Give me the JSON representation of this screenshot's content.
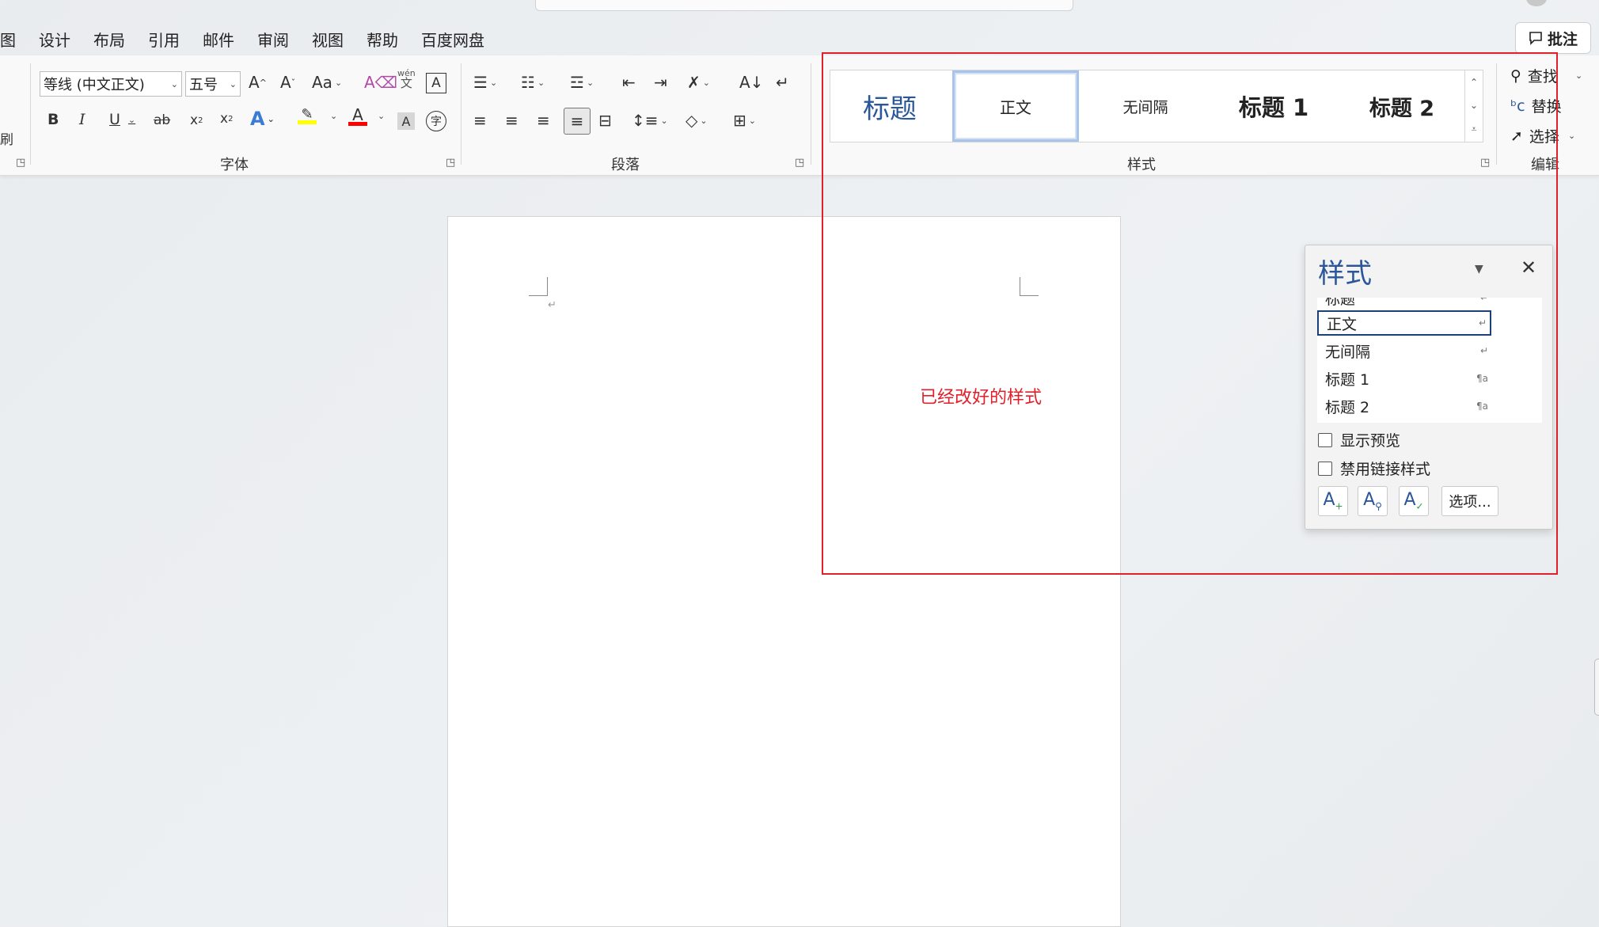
{
  "menu": [
    "图",
    "设计",
    "布局",
    "引用",
    "邮件",
    "审阅",
    "视图",
    "帮助",
    "百度网盘"
  ],
  "comment_button": "批注",
  "font_group": {
    "label": "字体",
    "font_name": "等线 (中文正文)",
    "font_size": "五号",
    "phonetic": "wén",
    "phonetic_char": "文",
    "left_stub": "刷"
  },
  "paragraph_group": {
    "label": "段落"
  },
  "styles_group": {
    "label": "样式",
    "gallery": [
      "标题",
      "正文",
      "无间隔",
      "标题 1",
      "标题 2"
    ],
    "selected": "正文"
  },
  "editing_group": {
    "label": "编辑",
    "find": "查找",
    "replace": "替换",
    "select": "选择"
  },
  "annotation": "已经改好的样式",
  "styles_pane": {
    "title": "样式",
    "list": [
      {
        "name": "标题",
        "mark": "↵"
      },
      {
        "name": "正文",
        "mark": "↵"
      },
      {
        "name": "无间隔",
        "mark": "↵"
      },
      {
        "name": "标题 1",
        "mark": "¶a"
      },
      {
        "name": "标题 2",
        "mark": "¶a"
      }
    ],
    "show_preview": "显示预览",
    "disable_linked": "禁用链接样式",
    "options_button": "选项..."
  },
  "colors": {
    "accent": "#2b579a",
    "annotation_red": "#e0202a",
    "highlight_yellow": "#ffff00",
    "font_color_red": "#ff0000"
  }
}
